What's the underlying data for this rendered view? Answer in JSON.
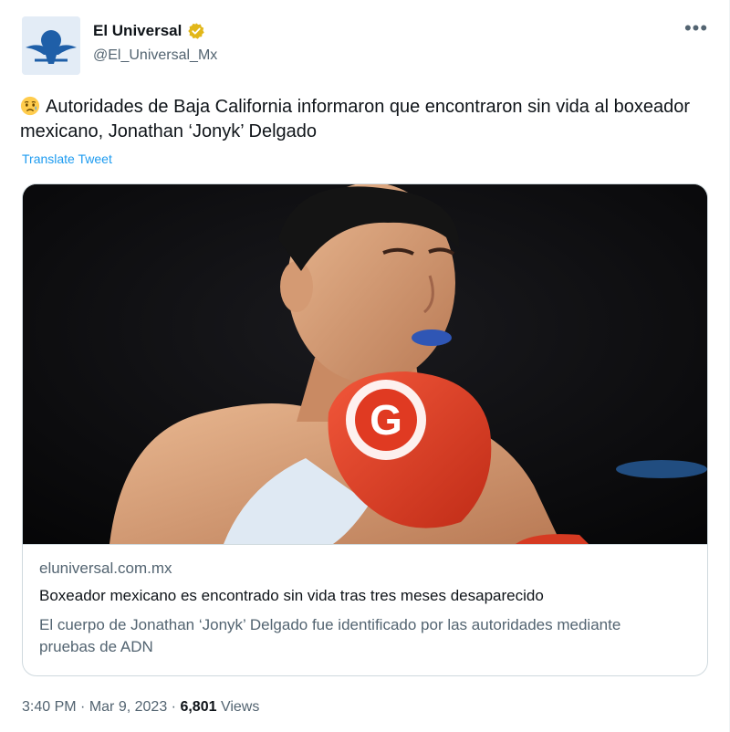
{
  "account": {
    "display_name": "El Universal",
    "handle": "@El_Universal_Mx",
    "verified_badge_color": "#e2b719"
  },
  "tweet": {
    "emoji": "sad-but-relieved-face-emoji",
    "text": "Autoridades de Baja California informaron que encontraron sin vida al boxeador mexicano, Jonathan ‘Jonyk’ Delgado",
    "translate_label": "Translate Tweet"
  },
  "card": {
    "domain": "eluniversal.com.mx",
    "title": "Boxeador mexicano es encontrado sin vida tras tres meses desaparecido",
    "description": "El cuerpo de Jonathan ‘Jonyk’ Delgado fue identificado por las autoridades mediante pruebas de ADN",
    "glove_letter": "G"
  },
  "meta": {
    "time": "3:40 PM",
    "separator": "·",
    "date": "Mar 9, 2023",
    "views_count": "6,801",
    "views_label": "Views"
  },
  "colors": {
    "link": "#1d9bf0",
    "secondary_text": "#536471",
    "primary_text": "#0f1419",
    "border": "#cfd9de"
  }
}
